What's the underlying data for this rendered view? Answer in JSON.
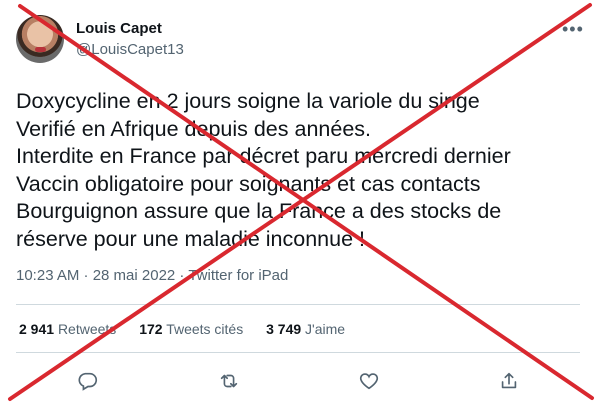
{
  "tweet": {
    "author_name": "Louis Capet",
    "author_handle": "@LouisCapet13",
    "lines": [
      "Doxycycline en 2 jours soigne la variole du singe",
      "Verifié en Afrique depuis des années.",
      "Interdite en France par décret paru mercredi dernier",
      "Vaccin obligatoire pour soignants et cas contacts",
      "Bourguignon assure que la France a des stocks de",
      "réserve pour une maladie inconnue !"
    ],
    "timestamp": "10:23 AM · 28 mai 2022 · ",
    "source": "Twitter for iPad"
  },
  "stats": {
    "retweets_count": "2 941",
    "retweets_label": "Retweets",
    "quotes_count": "172",
    "quotes_label": "Tweets cités",
    "likes_count": "3 749",
    "likes_label": "J'aime"
  },
  "overlay": {
    "cross_color": "#d9282f"
  },
  "icons": [
    "more-icon",
    "reply-icon",
    "retweet-icon",
    "like-icon",
    "share-icon"
  ]
}
